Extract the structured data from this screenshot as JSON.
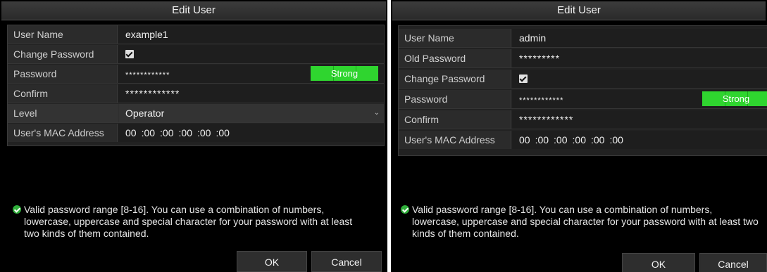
{
  "left_dialog": {
    "title": "Edit User",
    "fields": {
      "user_name_label": "User Name",
      "user_name_value": "example1",
      "change_password_label": "Change Password",
      "change_password_checked": true,
      "password_label": "Password",
      "password_value": "************",
      "password_strength": "Strong",
      "confirm_label": "Confirm",
      "confirm_value": "************",
      "level_label": "Level",
      "level_value": "Operator",
      "mac_label": "User's MAC Address",
      "mac_values": [
        "00",
        ":00",
        ":00",
        ":00",
        ":00",
        ":00"
      ]
    },
    "info_text": "Valid password range [8-16]. You can use a combination of numbers, lowercase, uppercase and special character for your password with at least two kinds of them contained.",
    "ok_label": "OK",
    "cancel_label": "Cancel"
  },
  "right_dialog": {
    "title": "Edit User",
    "fields": {
      "user_name_label": "User Name",
      "user_name_value": "admin",
      "old_password_label": "Old Password",
      "old_password_value": "*********",
      "change_password_label": "Change Password",
      "change_password_checked": true,
      "password_label": "Password",
      "password_value": "************",
      "password_strength": "Strong",
      "confirm_label": "Confirm",
      "confirm_value": "************",
      "mac_label": "User's MAC Address",
      "mac_values": [
        "00",
        ":00",
        ":00",
        ":00",
        ":00",
        ":00"
      ]
    },
    "info_text": "Valid password range [8-16]. You can use a combination of numbers, lowercase, uppercase and special character for your password with at least two kinds of them contained.",
    "ok_label": "OK",
    "cancel_label": "Cancel"
  },
  "colors": {
    "strength_green": "#2fd52f",
    "info_icon_green": "#2fae3a",
    "background": "#000000"
  }
}
